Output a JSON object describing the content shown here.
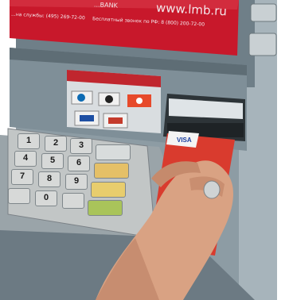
{
  "screen": {
    "url_text": "www.lmb.ru",
    "line1": "...на службы: (495) 269-72-00",
    "line2": "Бесплатный звонок по РФ: 8 (800) 200-72-00",
    "header_fragment": "...BANK"
  },
  "keypad": {
    "keys": [
      "1",
      "2",
      "3",
      "4",
      "5",
      "6",
      "7",
      "8",
      "9",
      "",
      "0",
      ""
    ]
  },
  "colors": {
    "screen_red": "#cc1a2e",
    "atm_body": "#7c8e99",
    "keypad_metal": "#b9bcbc",
    "function_key_yellow": "#e5c067",
    "function_key_green": "#a9c45a",
    "card_red": "#d63c2f",
    "skin": "#d9a283"
  }
}
